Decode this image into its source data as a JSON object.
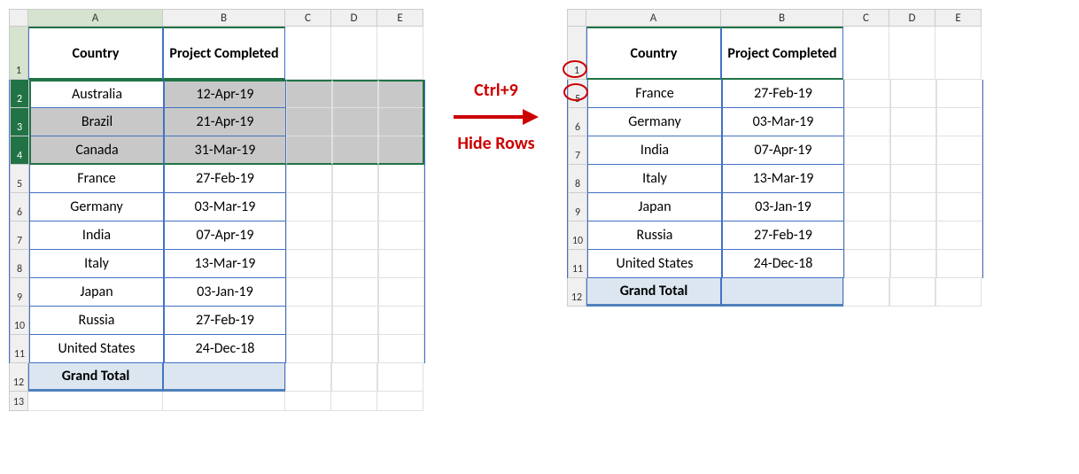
{
  "cols": [
    "A",
    "B",
    "C",
    "D",
    "E"
  ],
  "left": {
    "active_col": "A",
    "header": {
      "country": "Country",
      "project": "Project Completed"
    },
    "rows": [
      {
        "n": "1",
        "type": "header"
      },
      {
        "n": "2",
        "type": "data",
        "country": "Australia",
        "project": "12-Apr-19",
        "sel": true,
        "active": true
      },
      {
        "n": "3",
        "type": "data",
        "country": "Brazil",
        "project": "21-Apr-19",
        "sel": true
      },
      {
        "n": "4",
        "type": "data",
        "country": "Canada",
        "project": "31-Mar-19",
        "sel": true
      },
      {
        "n": "5",
        "type": "data",
        "country": "France",
        "project": "27-Feb-19"
      },
      {
        "n": "6",
        "type": "data",
        "country": "Germany",
        "project": "03-Mar-19"
      },
      {
        "n": "7",
        "type": "data",
        "country": "India",
        "project": "07-Apr-19"
      },
      {
        "n": "8",
        "type": "data",
        "country": "Italy",
        "project": "13-Mar-19"
      },
      {
        "n": "9",
        "type": "data",
        "country": "Japan",
        "project": "03-Jan-19"
      },
      {
        "n": "10",
        "type": "data",
        "country": "Russia",
        "project": "27-Feb-19"
      },
      {
        "n": "11",
        "type": "data",
        "country": "United States",
        "project": "24-Dec-18"
      },
      {
        "n": "12",
        "type": "total",
        "country": "Grand Total",
        "project": ""
      },
      {
        "n": "13",
        "type": "empty"
      }
    ]
  },
  "middle": {
    "shortcut": "Ctrl+9",
    "label": "Hide Rows"
  },
  "right": {
    "header": {
      "country": "Country",
      "project": "Project Completed"
    },
    "circled": [
      "1",
      "5"
    ],
    "rows": [
      {
        "n": "1",
        "type": "header"
      },
      {
        "n": "5",
        "type": "data",
        "country": "France",
        "project": "27-Feb-19"
      },
      {
        "n": "6",
        "type": "data",
        "country": "Germany",
        "project": "03-Mar-19"
      },
      {
        "n": "7",
        "type": "data",
        "country": "India",
        "project": "07-Apr-19"
      },
      {
        "n": "8",
        "type": "data",
        "country": "Italy",
        "project": "13-Mar-19"
      },
      {
        "n": "9",
        "type": "data",
        "country": "Japan",
        "project": "03-Jan-19"
      },
      {
        "n": "10",
        "type": "data",
        "country": "Russia",
        "project": "27-Feb-19"
      },
      {
        "n": "11",
        "type": "data",
        "country": "United States",
        "project": "24-Dec-18"
      },
      {
        "n": "12",
        "type": "total",
        "country": "Grand Total",
        "project": ""
      }
    ]
  }
}
